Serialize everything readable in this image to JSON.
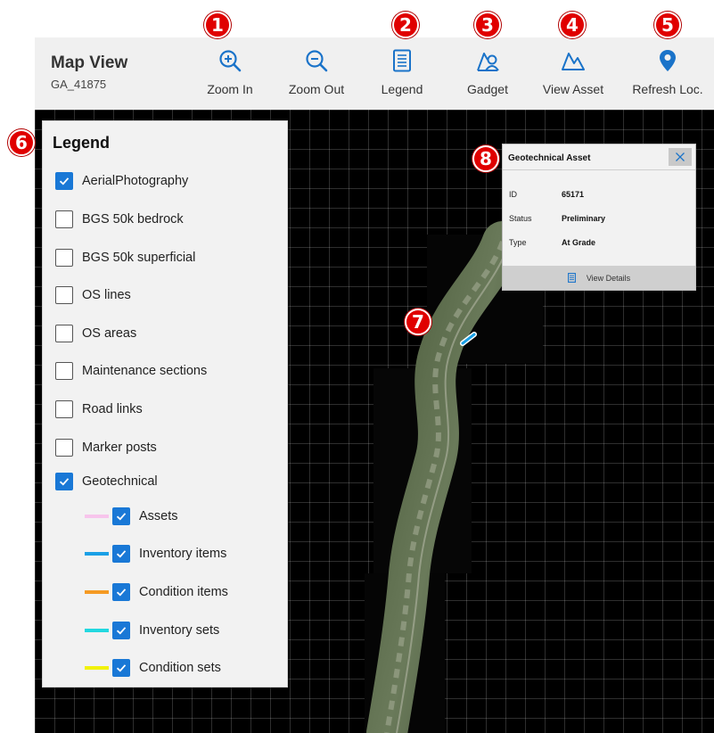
{
  "app": {
    "title": "Map View",
    "subtitle": "GA_41875"
  },
  "toolbar": {
    "zoom_in": "Zoom In",
    "zoom_out": "Zoom Out",
    "legend": "Legend",
    "gadget": "Gadget",
    "view_asset": "View Asset",
    "refresh_loc": "Refresh Loc."
  },
  "callouts": [
    "1",
    "2",
    "3",
    "4",
    "5",
    "6",
    "7",
    "8"
  ],
  "legend": {
    "title": "Legend",
    "layers": [
      {
        "label": "AerialPhotography",
        "checked": true
      },
      {
        "label": "BGS 50k bedrock",
        "checked": false
      },
      {
        "label": "BGS 50k superficial",
        "checked": false
      },
      {
        "label": "OS lines",
        "checked": false
      },
      {
        "label": "OS areas",
        "checked": false
      },
      {
        "label": "Maintenance sections",
        "checked": false
      },
      {
        "label": "Road links",
        "checked": false
      },
      {
        "label": "Marker posts",
        "checked": false
      },
      {
        "label": "Geotechnical",
        "checked": true
      }
    ],
    "sublayers": [
      {
        "label": "Assets",
        "checked": true,
        "color": "#f7c5ec"
      },
      {
        "label": "Inventory items",
        "checked": true,
        "color": "#1aa0e6"
      },
      {
        "label": "Condition items",
        "checked": true,
        "color": "#f59a23"
      },
      {
        "label": "Inventory sets",
        "checked": true,
        "color": "#22d8e0"
      },
      {
        "label": "Condition sets",
        "checked": true,
        "color": "#f2f20a"
      }
    ]
  },
  "popup": {
    "title": "Geotechnical Asset",
    "fields": [
      {
        "key": "ID",
        "value": "65171"
      },
      {
        "key": "Status",
        "value": "Preliminary"
      },
      {
        "key": "Type",
        "value": "At Grade"
      }
    ],
    "view_details": "View Details"
  },
  "colors": {
    "accent": "#1978d6",
    "callout": "#e00000",
    "icon_blue": "#1a73c9"
  }
}
